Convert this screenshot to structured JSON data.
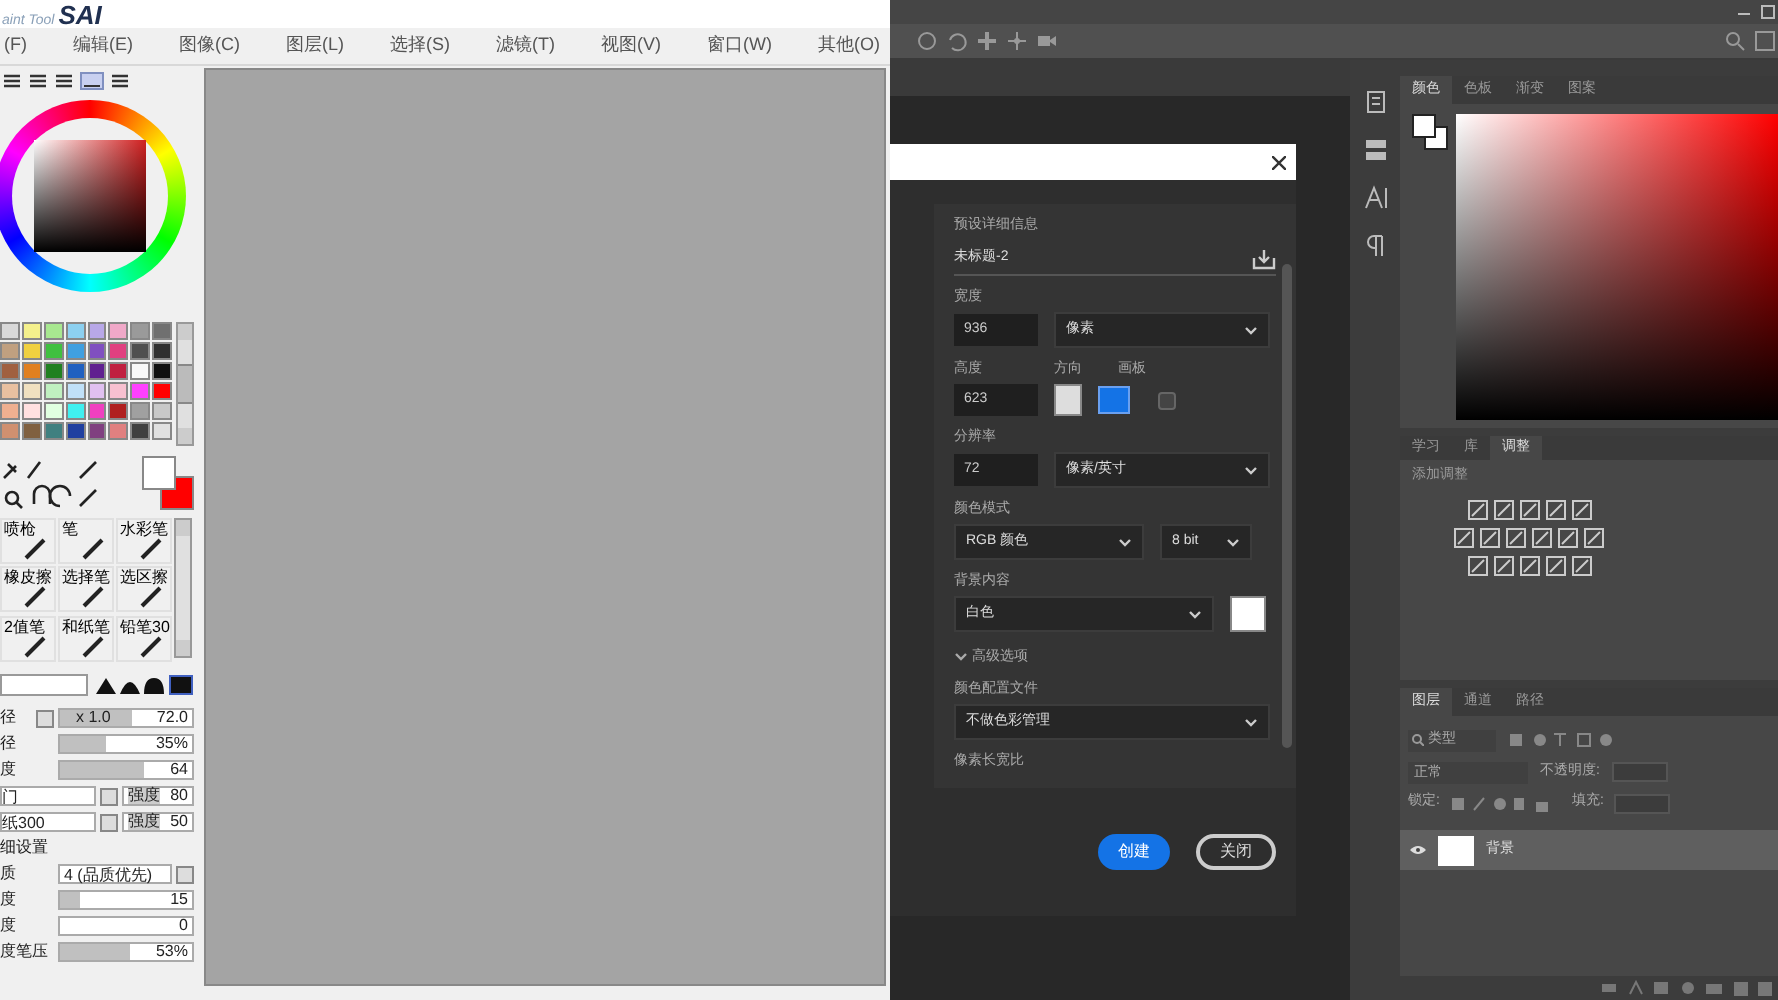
{
  "sai": {
    "logo_prefix": "aint Tool",
    "logo": "SAI",
    "menu": [
      "(F)",
      "编辑(E)",
      "图像(C)",
      "图层(L)",
      "选择(S)",
      "滤镜(T)",
      "视图(V)",
      "窗口(W)",
      "其他(O)"
    ],
    "swatches": [
      {
        "color": "#d8d8d8"
      },
      {
        "color": "#f4f08c"
      },
      {
        "color": "#a8e890"
      },
      {
        "color": "#8cd0f0"
      },
      {
        "color": "#b8a8e8"
      },
      {
        "color": "#f0a8c8"
      },
      {
        "color": "#9a9a9a"
      },
      {
        "color": "#707070"
      },
      {
        "color": "#c0a080"
      },
      {
        "color": "#f0d040"
      },
      {
        "color": "#40c040"
      },
      {
        "color": "#40a0e0"
      },
      {
        "color": "#8050c0"
      },
      {
        "color": "#e04080"
      },
      {
        "color": "#505050"
      },
      {
        "color": "#303030"
      },
      {
        "color": "#a06040"
      },
      {
        "color": "#e08020"
      },
      {
        "color": "#208020"
      },
      {
        "color": "#2060c0"
      },
      {
        "color": "#602090"
      },
      {
        "color": "#c02040"
      },
      {
        "color": "#f8f8f8"
      },
      {
        "color": "#101010"
      },
      {
        "color": "#e8c0a0"
      },
      {
        "color": "#f0e0c0"
      },
      {
        "color": "#c0f0c0"
      },
      {
        "color": "#c0e0f8"
      },
      {
        "color": "#e0c0f0"
      },
      {
        "color": "#f8c0d0"
      },
      {
        "color": "#ff40ff"
      },
      {
        "color": "#ff0000"
      },
      {
        "color": "#f0b090"
      },
      {
        "color": "#ffe0e0"
      },
      {
        "color": "#e0ffe0"
      },
      {
        "color": "#40f0f0"
      },
      {
        "color": "#f040c0"
      },
      {
        "color": "#b02020"
      },
      {
        "color": "#a0a0a0"
      },
      {
        "color": "#c8c8c8"
      },
      {
        "color": "#d09070"
      },
      {
        "color": "#806040"
      },
      {
        "color": "#408080"
      },
      {
        "color": "#2040a0"
      },
      {
        "color": "#804080"
      },
      {
        "color": "#e08080"
      },
      {
        "color": "#404040"
      },
      {
        "color": "#e0e0e0"
      }
    ],
    "brushes": [
      {
        "label": "喷枪",
        "selected": false
      },
      {
        "label": "笔",
        "selected": false
      },
      {
        "label": "水彩笔",
        "selected": false
      },
      {
        "label": "橡皮擦",
        "selected": false
      },
      {
        "label": "选择笔",
        "selected": false
      },
      {
        "label": "选区擦",
        "selected": false
      },
      {
        "label": "2值笔",
        "selected": false
      },
      {
        "label": "和纸笔",
        "selected": false
      },
      {
        "label": "铅笔30",
        "selected": false
      }
    ],
    "settings": [
      {
        "kind": "scaled",
        "label": "径",
        "scale": "x 1.0",
        "reading": "72.0",
        "level": 0.55
      },
      {
        "kind": "slider",
        "label": "径",
        "reading": "35%",
        "level": 0.35
      },
      {
        "kind": "slider",
        "label": "度",
        "reading": "64",
        "level": 0.64
      },
      {
        "kind": "combo",
        "label": "门",
        "strength_label": "强度",
        "reading": "80"
      },
      {
        "kind": "combo",
        "label": "纸300",
        "strength_label": "强度",
        "reading": "50"
      },
      {
        "kind": "heading",
        "label": "细设置"
      },
      {
        "kind": "select",
        "label": "质",
        "value": "4 (品质优先)"
      },
      {
        "kind": "slider",
        "label": "度",
        "reading": "15",
        "level": 0.15
      },
      {
        "kind": "slider",
        "label": "度",
        "reading": "0",
        "level": 0
      },
      {
        "kind": "slider",
        "label": "度笔压",
        "reading": "53%",
        "level": 0.53
      }
    ]
  },
  "photoshop": {
    "dialog": {
      "section": "预设详细信息",
      "name": "未标题-2",
      "fields": [
        {
          "kind": "input_select",
          "label": "宽度",
          "value": "936",
          "unit": "像素"
        },
        {
          "kind": "orientation",
          "label": "高度",
          "value": "623",
          "orientation_label": "方向",
          "artboard_label": "画板",
          "artboard": false,
          "portrait": false
        },
        {
          "kind": "input_select",
          "label": "分辨率",
          "value": "72",
          "unit": "像素/英寸"
        },
        {
          "kind": "two_selects",
          "label": "颜色模式",
          "value": "RGB 颜色",
          "unit": "8 bit"
        },
        {
          "kind": "select_swatch",
          "label": "背景内容",
          "value": "白色",
          "color": "#ffffff"
        },
        {
          "kind": "expander",
          "label": "高级选项"
        },
        {
          "kind": "select",
          "label": "颜色配置文件",
          "value": "不做色彩管理"
        },
        {
          "kind": "label",
          "label": "像素长宽比"
        }
      ],
      "buttons": [
        {
          "label": "创建",
          "primary": true
        },
        {
          "label": "关闭",
          "primary": false
        }
      ]
    },
    "color_tabs": [
      {
        "label": "颜色",
        "selected": true
      },
      {
        "label": "色板",
        "selected": false
      },
      {
        "label": "渐变",
        "selected": false
      },
      {
        "label": "图案",
        "selected": false
      }
    ],
    "adjust_tabs": [
      {
        "label": "学习",
        "selected": false
      },
      {
        "label": "库",
        "selected": false
      },
      {
        "label": "调整",
        "selected": true
      }
    ],
    "adjust_title": "添加调整",
    "layer_tabs": [
      {
        "label": "图层",
        "selected": true
      },
      {
        "label": "通道",
        "selected": false
      },
      {
        "label": "路径",
        "selected": false
      }
    ],
    "layer_filter": "类型",
    "blend_mode": "正常",
    "opacity_label": "不透明度:",
    "lock_label": "锁定:",
    "fill_label": "填充:",
    "layers": [
      {
        "name": "背景",
        "visible": true,
        "selected": true
      }
    ]
  }
}
